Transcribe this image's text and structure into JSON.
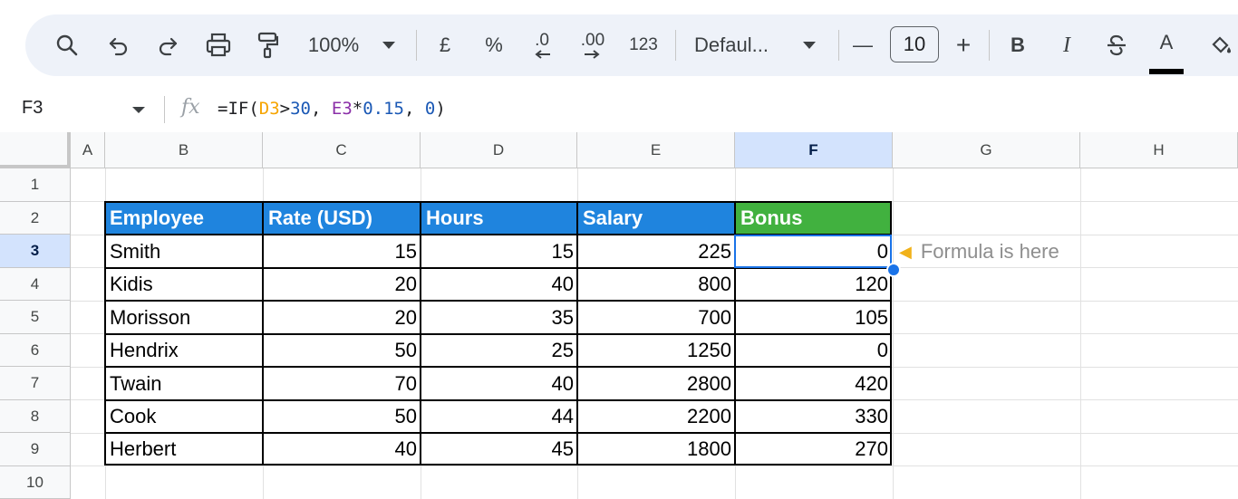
{
  "toolbar": {
    "zoom": "100%",
    "currency": "£",
    "percent": "%",
    "decrease_decimal": ".0",
    "increase_decimal": ".00",
    "number_format": "123",
    "font_family": "Defaul...",
    "font_size": "10",
    "minus": "—",
    "plus": "+",
    "bold": "B",
    "italic": "I",
    "text_color_letter": "A",
    "icons": [
      "search-icon",
      "undo-icon",
      "redo-icon",
      "print-icon",
      "paint-format-icon",
      "chevron-down-icon",
      "strikethrough-icon",
      "fill-color-icon"
    ]
  },
  "formula_bar": {
    "cell_ref": "F3",
    "fx": "fx",
    "formula_parts": {
      "prefix": "=IF(",
      "ref1": "D3",
      "op": ">",
      "num1": "30",
      "comma1": ", ",
      "ref2": "E3",
      "mult": "*",
      "num2": "0.15",
      "comma2": ", ",
      "num3": "0",
      "suffix": ")"
    }
  },
  "grid": {
    "columns": [
      "A",
      "B",
      "C",
      "D",
      "E",
      "F",
      "G",
      "H"
    ],
    "selected_column": "F",
    "rows": [
      "1",
      "2",
      "3",
      "4",
      "5",
      "6",
      "7",
      "8",
      "9",
      "10"
    ],
    "selected_row": "3"
  },
  "table": {
    "headers": [
      "Employee",
      "Rate (USD)",
      "Hours",
      "Salary",
      "Bonus"
    ],
    "rows": [
      [
        "Smith",
        "15",
        "15",
        "225",
        "0"
      ],
      [
        "Kidis",
        "20",
        "40",
        "800",
        "120"
      ],
      [
        "Morisson",
        "20",
        "35",
        "700",
        "105"
      ],
      [
        "Hendrix",
        "50",
        "25",
        "1250",
        "0"
      ],
      [
        "Twain",
        "70",
        "40",
        "2800",
        "420"
      ],
      [
        "Cook",
        "50",
        "44",
        "2200",
        "330"
      ],
      [
        "Herbert",
        "40",
        "45",
        "1800",
        "270"
      ]
    ],
    "colors": {
      "header_blue": "#1f84de",
      "header_green": "#41b13f",
      "selection": "#1a73e8"
    }
  },
  "annotation": {
    "icon": "pointing-hand-icon",
    "text": "Formula is here"
  }
}
